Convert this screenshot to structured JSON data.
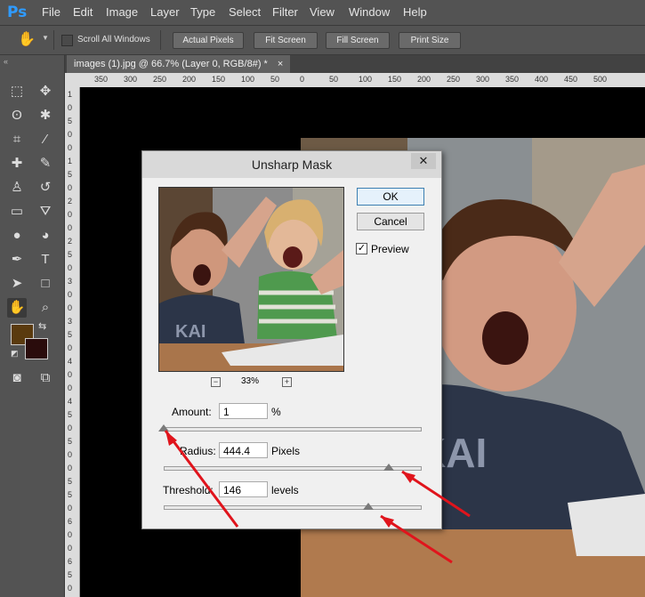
{
  "app": {
    "logo": "Ps"
  },
  "menu": [
    "File",
    "Edit",
    "Image",
    "Layer",
    "Type",
    "Select",
    "Filter",
    "View",
    "Window",
    "Help"
  ],
  "options": {
    "scroll_all_label": "Scroll All Windows",
    "buttons": [
      "Actual Pixels",
      "Fit Screen",
      "Fill Screen",
      "Print Size"
    ]
  },
  "document": {
    "tab_title": "images (1).jpg @ 66.7% (Layer 0, RGB/8#) *",
    "tab_close": "×"
  },
  "ruler": {
    "top": [
      "350",
      "300",
      "250",
      "200",
      "150",
      "100",
      "50",
      "0",
      "50",
      "100",
      "150",
      "200",
      "250",
      "300",
      "350",
      "400",
      "450",
      "500"
    ],
    "left": [
      "1",
      "0",
      "5",
      "0",
      "0",
      "1",
      "5",
      "0",
      "2",
      "0",
      "0",
      "2",
      "5",
      "0",
      "3",
      "0",
      "0",
      "3",
      "5",
      "0",
      "4",
      "0",
      "0",
      "4",
      "5",
      "0",
      "5",
      "0",
      "0",
      "5",
      "5",
      "0",
      "6",
      "0",
      "0",
      "6",
      "5",
      "0"
    ]
  },
  "dialog": {
    "title": "Unsharp Mask",
    "close": "✕",
    "ok": "OK",
    "cancel": "Cancel",
    "preview_label": "Preview",
    "preview_checked": true,
    "zoom": "33%",
    "zoom_out": "−",
    "zoom_in": "+",
    "amount": {
      "label": "Amount:",
      "value": "1",
      "unit": "%",
      "slider": 0.0
    },
    "radius": {
      "label": "Radius:",
      "value": "444.4",
      "unit": "Pixels",
      "slider": 0.88
    },
    "threshold": {
      "label": "Threshold:",
      "value": "146",
      "unit": "levels",
      "slider": 0.8
    }
  },
  "colors": {
    "foreground": "#5a3a0e",
    "background": "#2a0c0c",
    "arrow": "#e0141c"
  }
}
